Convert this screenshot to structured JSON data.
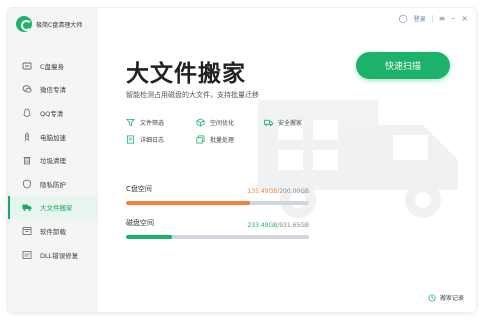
{
  "app": {
    "name": "极简C盘清理大师"
  },
  "topbar": {
    "login_label": "登录",
    "menu_icon": "menu-icon",
    "min_icon": "minimize-icon",
    "close_icon": "close-icon"
  },
  "sidebar": {
    "items": [
      {
        "label": "C盘瘦身",
        "icon": "disk-slim-icon",
        "active": false
      },
      {
        "label": "微信专清",
        "icon": "wechat-icon",
        "active": false
      },
      {
        "label": "QQ专清",
        "icon": "qq-icon",
        "active": false
      },
      {
        "label": "电脑加速",
        "icon": "rocket-icon",
        "active": false
      },
      {
        "label": "垃圾清理",
        "icon": "trash-icon",
        "active": false
      },
      {
        "label": "隐私防护",
        "icon": "shield-icon",
        "active": false
      },
      {
        "label": "大文件搬家",
        "icon": "truck-icon",
        "active": true
      },
      {
        "label": "软件卸载",
        "icon": "uninstall-icon",
        "active": false
      },
      {
        "label": "DLL错误修复",
        "icon": "dll-icon",
        "active": false
      }
    ]
  },
  "main": {
    "title": "大文件搬家",
    "subtitle": "智能检测占用磁盘的大文件，支持批量迁移",
    "scan_button": "快速扫描",
    "features": [
      {
        "label": "文件筛选",
        "icon": "filter-icon"
      },
      {
        "label": "空间优化",
        "icon": "cube-icon"
      },
      {
        "label": "安全搬家",
        "icon": "truck-small-icon"
      },
      {
        "label": "详细日志",
        "icon": "log-icon"
      },
      {
        "label": "批量处理",
        "icon": "batch-icon"
      }
    ],
    "disks": [
      {
        "label": "C盘空间",
        "used": "135.49GB",
        "total": "/200.00GB",
        "fraction": 0.677,
        "color": "#f0823c",
        "used_color": "#f0823c"
      },
      {
        "label": "磁盘空间",
        "used": "233.49GB",
        "total": "/931.65GB",
        "fraction": 0.251,
        "color": "#1cb26a",
        "used_color": "#1cb26a"
      }
    ],
    "record_label": "搬家记录"
  }
}
